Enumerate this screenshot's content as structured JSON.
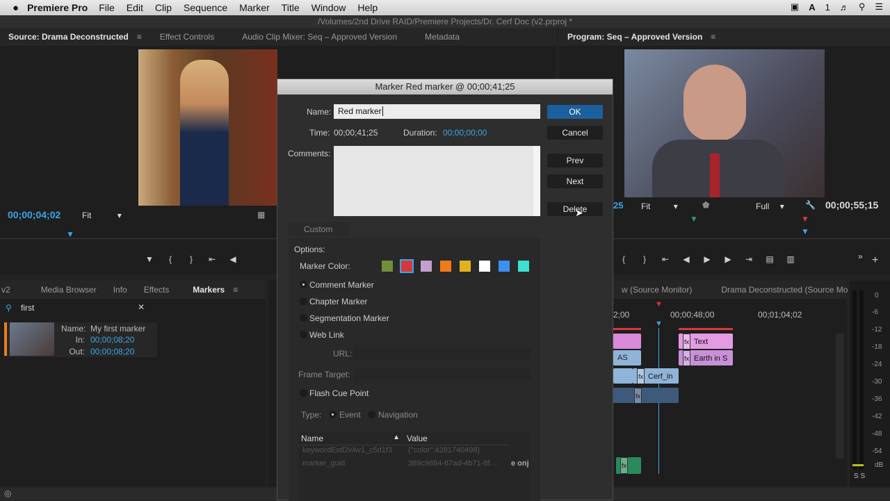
{
  "menubar": {
    "apple": "",
    "app": "Premiere Pro",
    "items": [
      "File",
      "Edit",
      "Clip",
      "Sequence",
      "Marker",
      "Title",
      "Window",
      "Help"
    ],
    "status": "1"
  },
  "path": "/Volumes/2nd Drive RAID/Premiere Projects/Dr. Cerf Doc (v2.prproj *",
  "source": {
    "tabs": [
      "Source: Drama Deconstructed",
      "Effect Controls",
      "Audio Clip Mixer: Seq – Approved Version",
      "Metadata"
    ],
    "menu": "≡",
    "timecode": "00;00;04;02",
    "fit": "Fit"
  },
  "program": {
    "tab": "Program: Seq – Approved Version",
    "menu": "≡",
    "timecode_partial": "25",
    "fit": "Fit",
    "full": "Full",
    "timecode": "00;00;55;15"
  },
  "project": {
    "tabs": [
      "v2",
      "Media Browser",
      "Info",
      "Effects",
      "Markers"
    ],
    "menu": "≡",
    "search": "first",
    "marker": {
      "name_label": "Name:",
      "name": "My first marker",
      "in_label": "In:",
      "in": "00;00;08;20",
      "out_label": "Out:",
      "out": "00;00;08;20"
    }
  },
  "timeline": {
    "tabs": [
      "w (Source Monitor)",
      "Drama Deconstructed (Source Mo"
    ],
    "ruler": [
      "2;00",
      "00;00;48;00",
      "00;01;04;02"
    ],
    "clips": {
      "text": "Text",
      "earth": "Earth in S",
      "cerf": "Cerf_in",
      "small_a": "AS"
    }
  },
  "meter": {
    "labels": [
      "0",
      "-6",
      "-12",
      "-18",
      "-24",
      "-30",
      "-36",
      "-42",
      "-48",
      "-54",
      "dB"
    ],
    "solo": "S S"
  },
  "dialog": {
    "title": "Marker Red marker @ 00;00;41;25",
    "name_label": "Name:",
    "name_value": "Red marker",
    "time_label": "Time:",
    "time_value": "00;00;41;25",
    "duration_label": "Duration:",
    "duration_value": "00;00;00;00",
    "comments_label": "Comments:",
    "buttons": {
      "ok": "OK",
      "cancel": "Cancel",
      "prev": "Prev",
      "next": "Next",
      "delete": "Delete"
    },
    "custom": "Custom",
    "options_label": "Options:",
    "marker_color_label": "Marker Color:",
    "colors": [
      "#6f8f3a",
      "#d8383c",
      "#c49ed0",
      "#ef7c1a",
      "#e2b21e",
      "#ffffff",
      "#3d8ff0",
      "#3ee0d0"
    ],
    "types": [
      "Comment Marker",
      "Chapter Marker",
      "Segmentation Marker",
      "Web Link"
    ],
    "url_label": "URL:",
    "frame_target_label": "Frame Target:",
    "flash_label": "Flash Cue Point",
    "type_label": "Type:",
    "event": "Event",
    "navigation": "Navigation",
    "table": {
      "headers": [
        "Name",
        "Value"
      ],
      "rows": [
        [
          "keywordExtDVAv1_c5d1f3",
          "{\"color\":4281740498}"
        ],
        [
          "marker_guid",
          "389c9884-67ad-4b71-8f…"
        ]
      ],
      "overflow": "e onj"
    }
  }
}
